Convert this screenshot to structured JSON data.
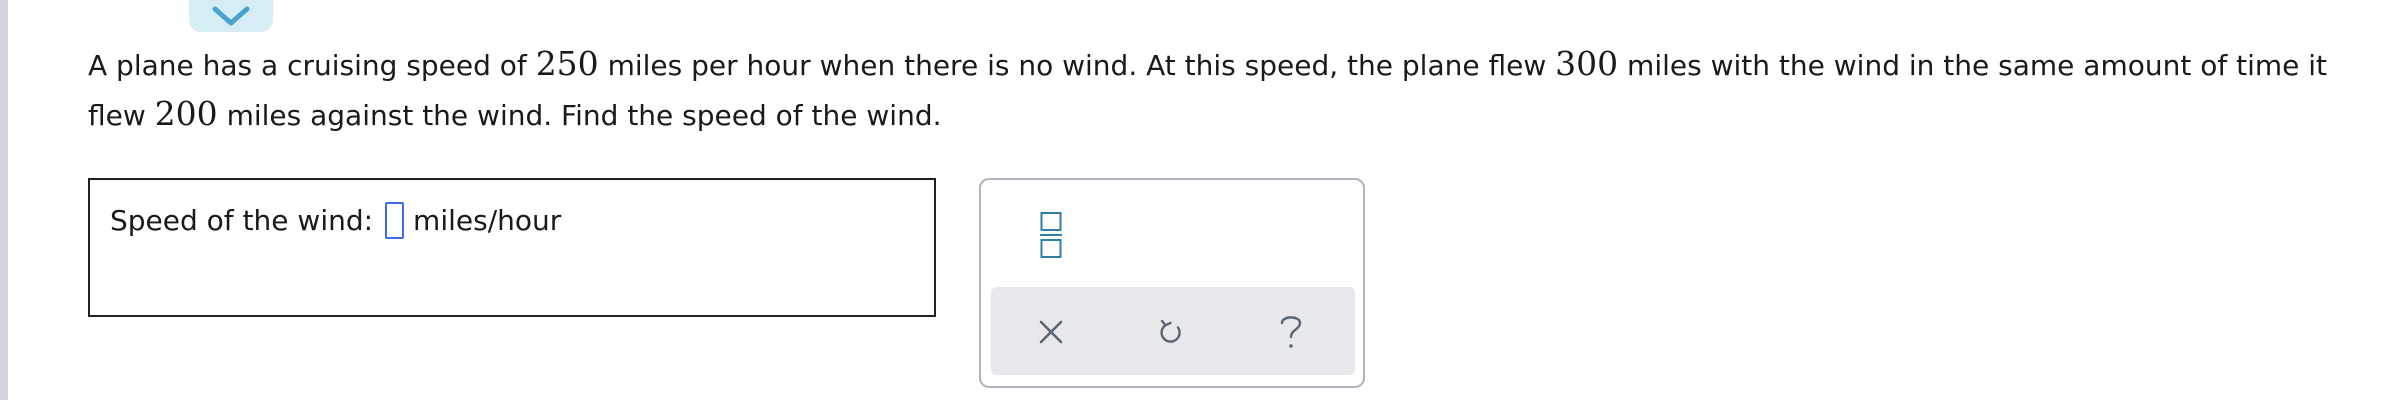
{
  "question": {
    "part1": "A plane has a cruising speed of ",
    "speed": "250",
    "part2": " miles per hour when there is no wind. At this speed, the plane flew ",
    "with_wind_distance": "300",
    "part3": " miles with the wind in the same amount of time it flew ",
    "against_wind_distance": "200",
    "part4": " miles against the wind. Find the speed of the wind."
  },
  "answer": {
    "label": "Speed of the wind:",
    "value": "",
    "unit": "miles/hour"
  },
  "tools": {
    "fraction_icon": "fraction-template-icon",
    "clear_icon": "close-icon",
    "undo_icon": "undo-icon",
    "help_icon": "question-mark-icon"
  },
  "colors": {
    "accent": "#3b6df2",
    "tool_icon": "#5a6472",
    "fraction_icon": "#2f7fa8",
    "collapse_tab": "#d7edf6",
    "collapse_chevron": "#4aa3cf"
  }
}
